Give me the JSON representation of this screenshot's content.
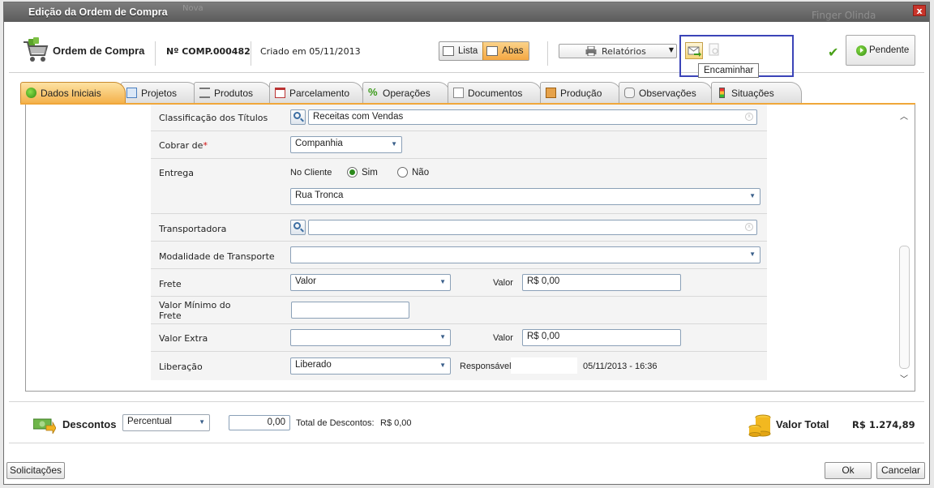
{
  "window": {
    "title": "Edição da Ordem de Compra",
    "background_text": [
      "Nova",
      "Finger Olinda"
    ]
  },
  "header": {
    "title": "Ordem de Compra",
    "number": "Nº COMP.000482",
    "created": "Criado em 05/11/2013",
    "view_list": "Lista",
    "view_tabs": "Abas",
    "reports": "Relatórios",
    "tooltip": "Encaminhar",
    "status": "Pendente"
  },
  "tabs": [
    {
      "label": "Dados Iniciais",
      "icon": "play-circle-icon"
    },
    {
      "label": "Projetos",
      "icon": "document-icon"
    },
    {
      "label": "Produtos",
      "icon": "list-icon"
    },
    {
      "label": "Parcelamento",
      "icon": "calendar-icon"
    },
    {
      "label": "Operações",
      "icon": "percent-icon"
    },
    {
      "label": "Documentos",
      "icon": "documents-icon"
    },
    {
      "label": "Produção",
      "icon": "factory-icon"
    },
    {
      "label": "Observações",
      "icon": "comment-icon"
    },
    {
      "label": "Situações",
      "icon": "traffic-light-icon"
    }
  ],
  "form": {
    "classificacao": {
      "label": "Classificação dos Títulos",
      "value": "Receitas com Vendas"
    },
    "cobrar": {
      "label": "Cobrar de",
      "required": "*",
      "value": "Companhia"
    },
    "entrega": {
      "label": "Entrega",
      "no_cliente": "No Cliente",
      "sim": "Sim",
      "nao": "Não",
      "address": "Rua Tronca"
    },
    "transportadora": {
      "label": "Transportadora",
      "value": ""
    },
    "modalidade": {
      "label": "Modalidade de Transporte",
      "value": ""
    },
    "frete": {
      "label": "Frete",
      "type": "Valor",
      "valor_label": "Valor",
      "valor": "R$ 0,00"
    },
    "valor_minimo": {
      "label_line1": "Valor Mínimo do",
      "label_line2": "Frete",
      "value": ""
    },
    "valor_extra": {
      "label": "Valor Extra",
      "type": "",
      "valor_label": "Valor",
      "valor": "R$ 0,00"
    },
    "liberacao": {
      "label": "Liberação",
      "value": "Liberado",
      "responsavel_label": "Responsável",
      "responsavel": "",
      "datetime": "05/11/2013 - 16:36"
    }
  },
  "footer": {
    "descontos": "Descontos",
    "desconto_tipo": "Percentual",
    "desconto_valor": "0,00",
    "total_descontos_label": "Total de Descontos:",
    "total_descontos": "R$ 0,00",
    "valor_total_label": "Valor Total",
    "valor_total": "R$ 1.274,89"
  },
  "buttons": {
    "solicitacoes": "Solicitações",
    "ok": "Ok",
    "cancelar": "Cancelar"
  },
  "colors": {
    "accent": "#f4b24c",
    "highlight": "#3b44b8",
    "close": "#c9342a"
  }
}
